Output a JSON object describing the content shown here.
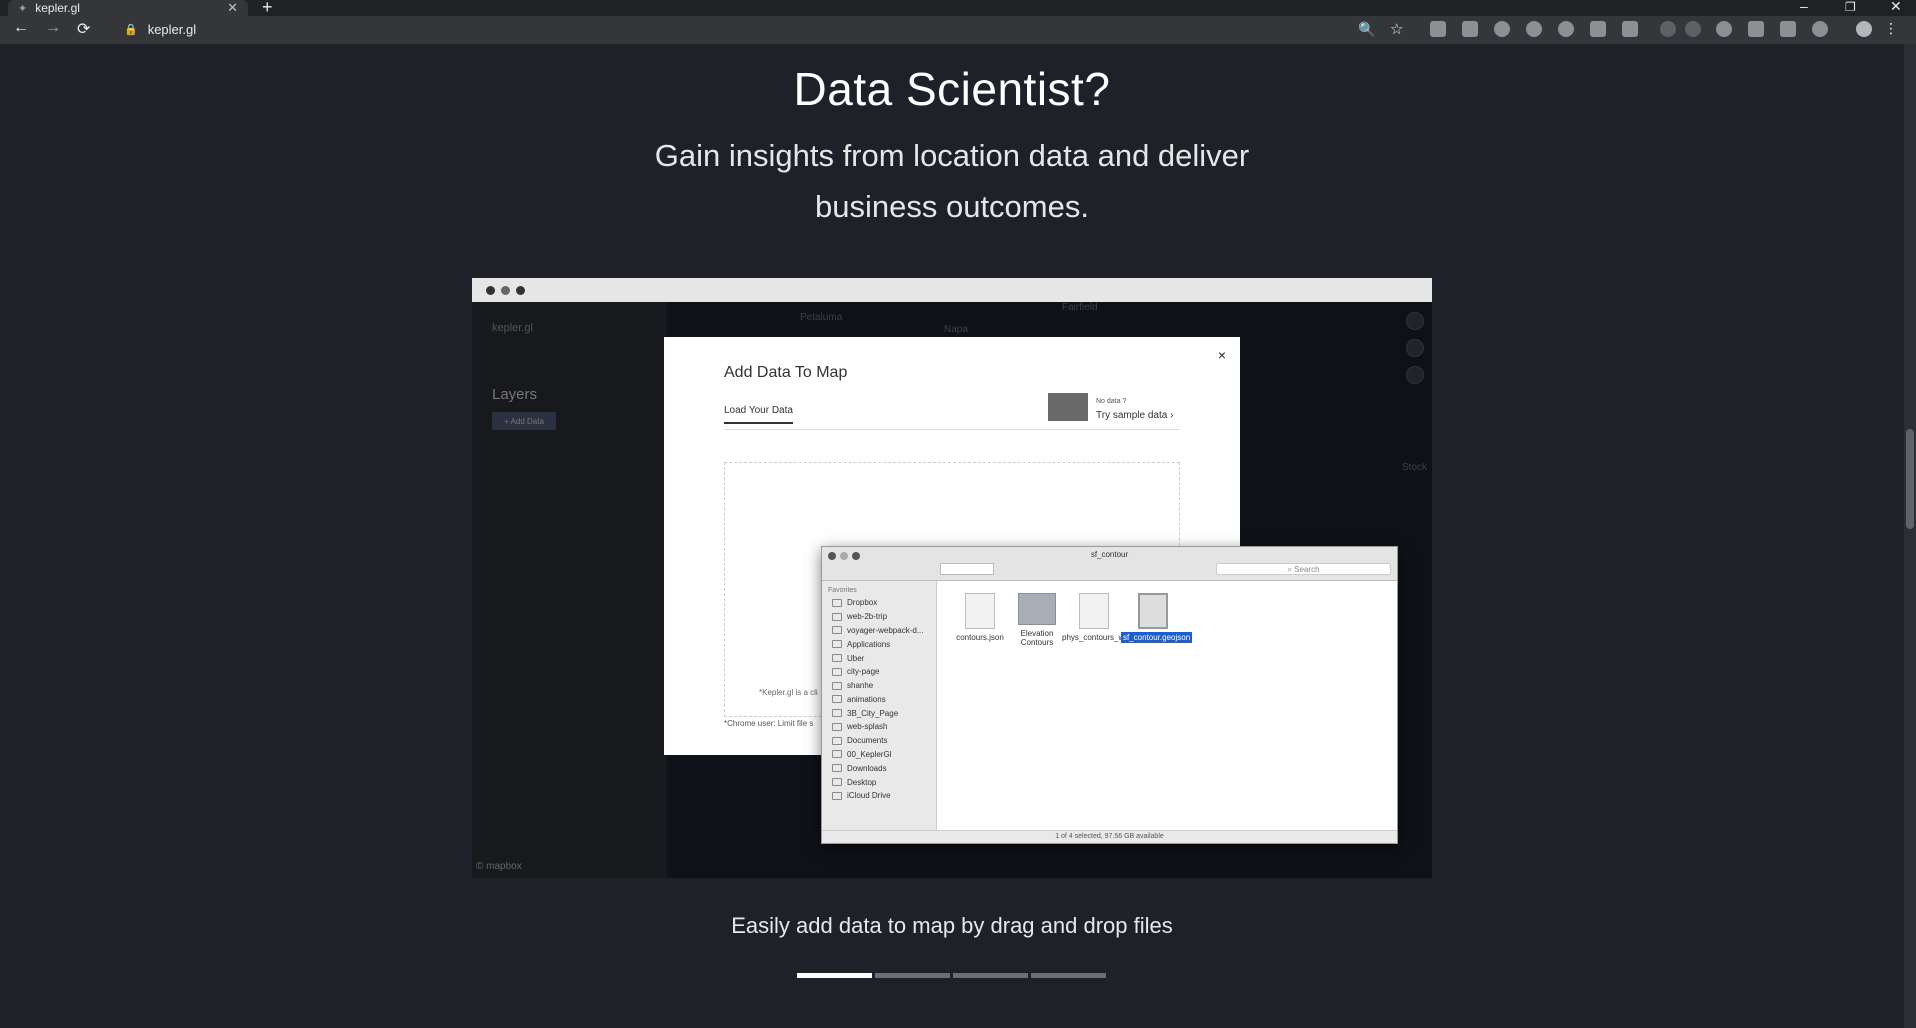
{
  "browser": {
    "tab_title": "kepler.gl",
    "tab_close": "✕",
    "new_tab": "+",
    "url": "kepler.gl",
    "back": "←",
    "forward": "→",
    "reload": "⟳",
    "minimize": "–",
    "restore": "❐",
    "close": "✕"
  },
  "hero": {
    "title": "Data Scientist?",
    "subtitle": "Gain insights from location data and deliver business outcomes."
  },
  "demo": {
    "sidebar_brand": "kepler.gl",
    "layers_heading": "Layers",
    "add_data": "+ Add Data",
    "map_labels": [
      "Petaluma",
      "Fairfield",
      "Napa",
      "Stock"
    ],
    "mapbox": "© mapbox"
  },
  "modal": {
    "title": "Add Data To Map",
    "close": "×",
    "tab_load": "Load Your Data",
    "no_data": "No data ?",
    "try_sample": "Try sample data",
    "drop_note": "*Kepler.gl is a cli",
    "chrome_note": "*Chrome user: Limit file s"
  },
  "finder": {
    "title": "sf_contour",
    "search": "Search",
    "sidebar_header": "Favorites",
    "sidebar_items": [
      "Dropbox",
      "web-2b-trip",
      "voyager-webpack-d...",
      "Applications",
      "Uber",
      "city-page",
      "shanhe",
      "animations",
      "3B_City_Page",
      "web-splash",
      "Documents",
      "00_KeplerGl",
      "Downloads",
      "Desktop",
      "iCloud Drive"
    ],
    "files": [
      "contours.json",
      "Elevation Contours",
      "phys_contours_wgs.csv",
      "sf_contour.geojson"
    ],
    "status": "1 of 4 selected, 97.56 GB available"
  },
  "caption": "Easily add data to map by drag and drop files",
  "carousel": {
    "active_index": 0,
    "count": 4
  }
}
